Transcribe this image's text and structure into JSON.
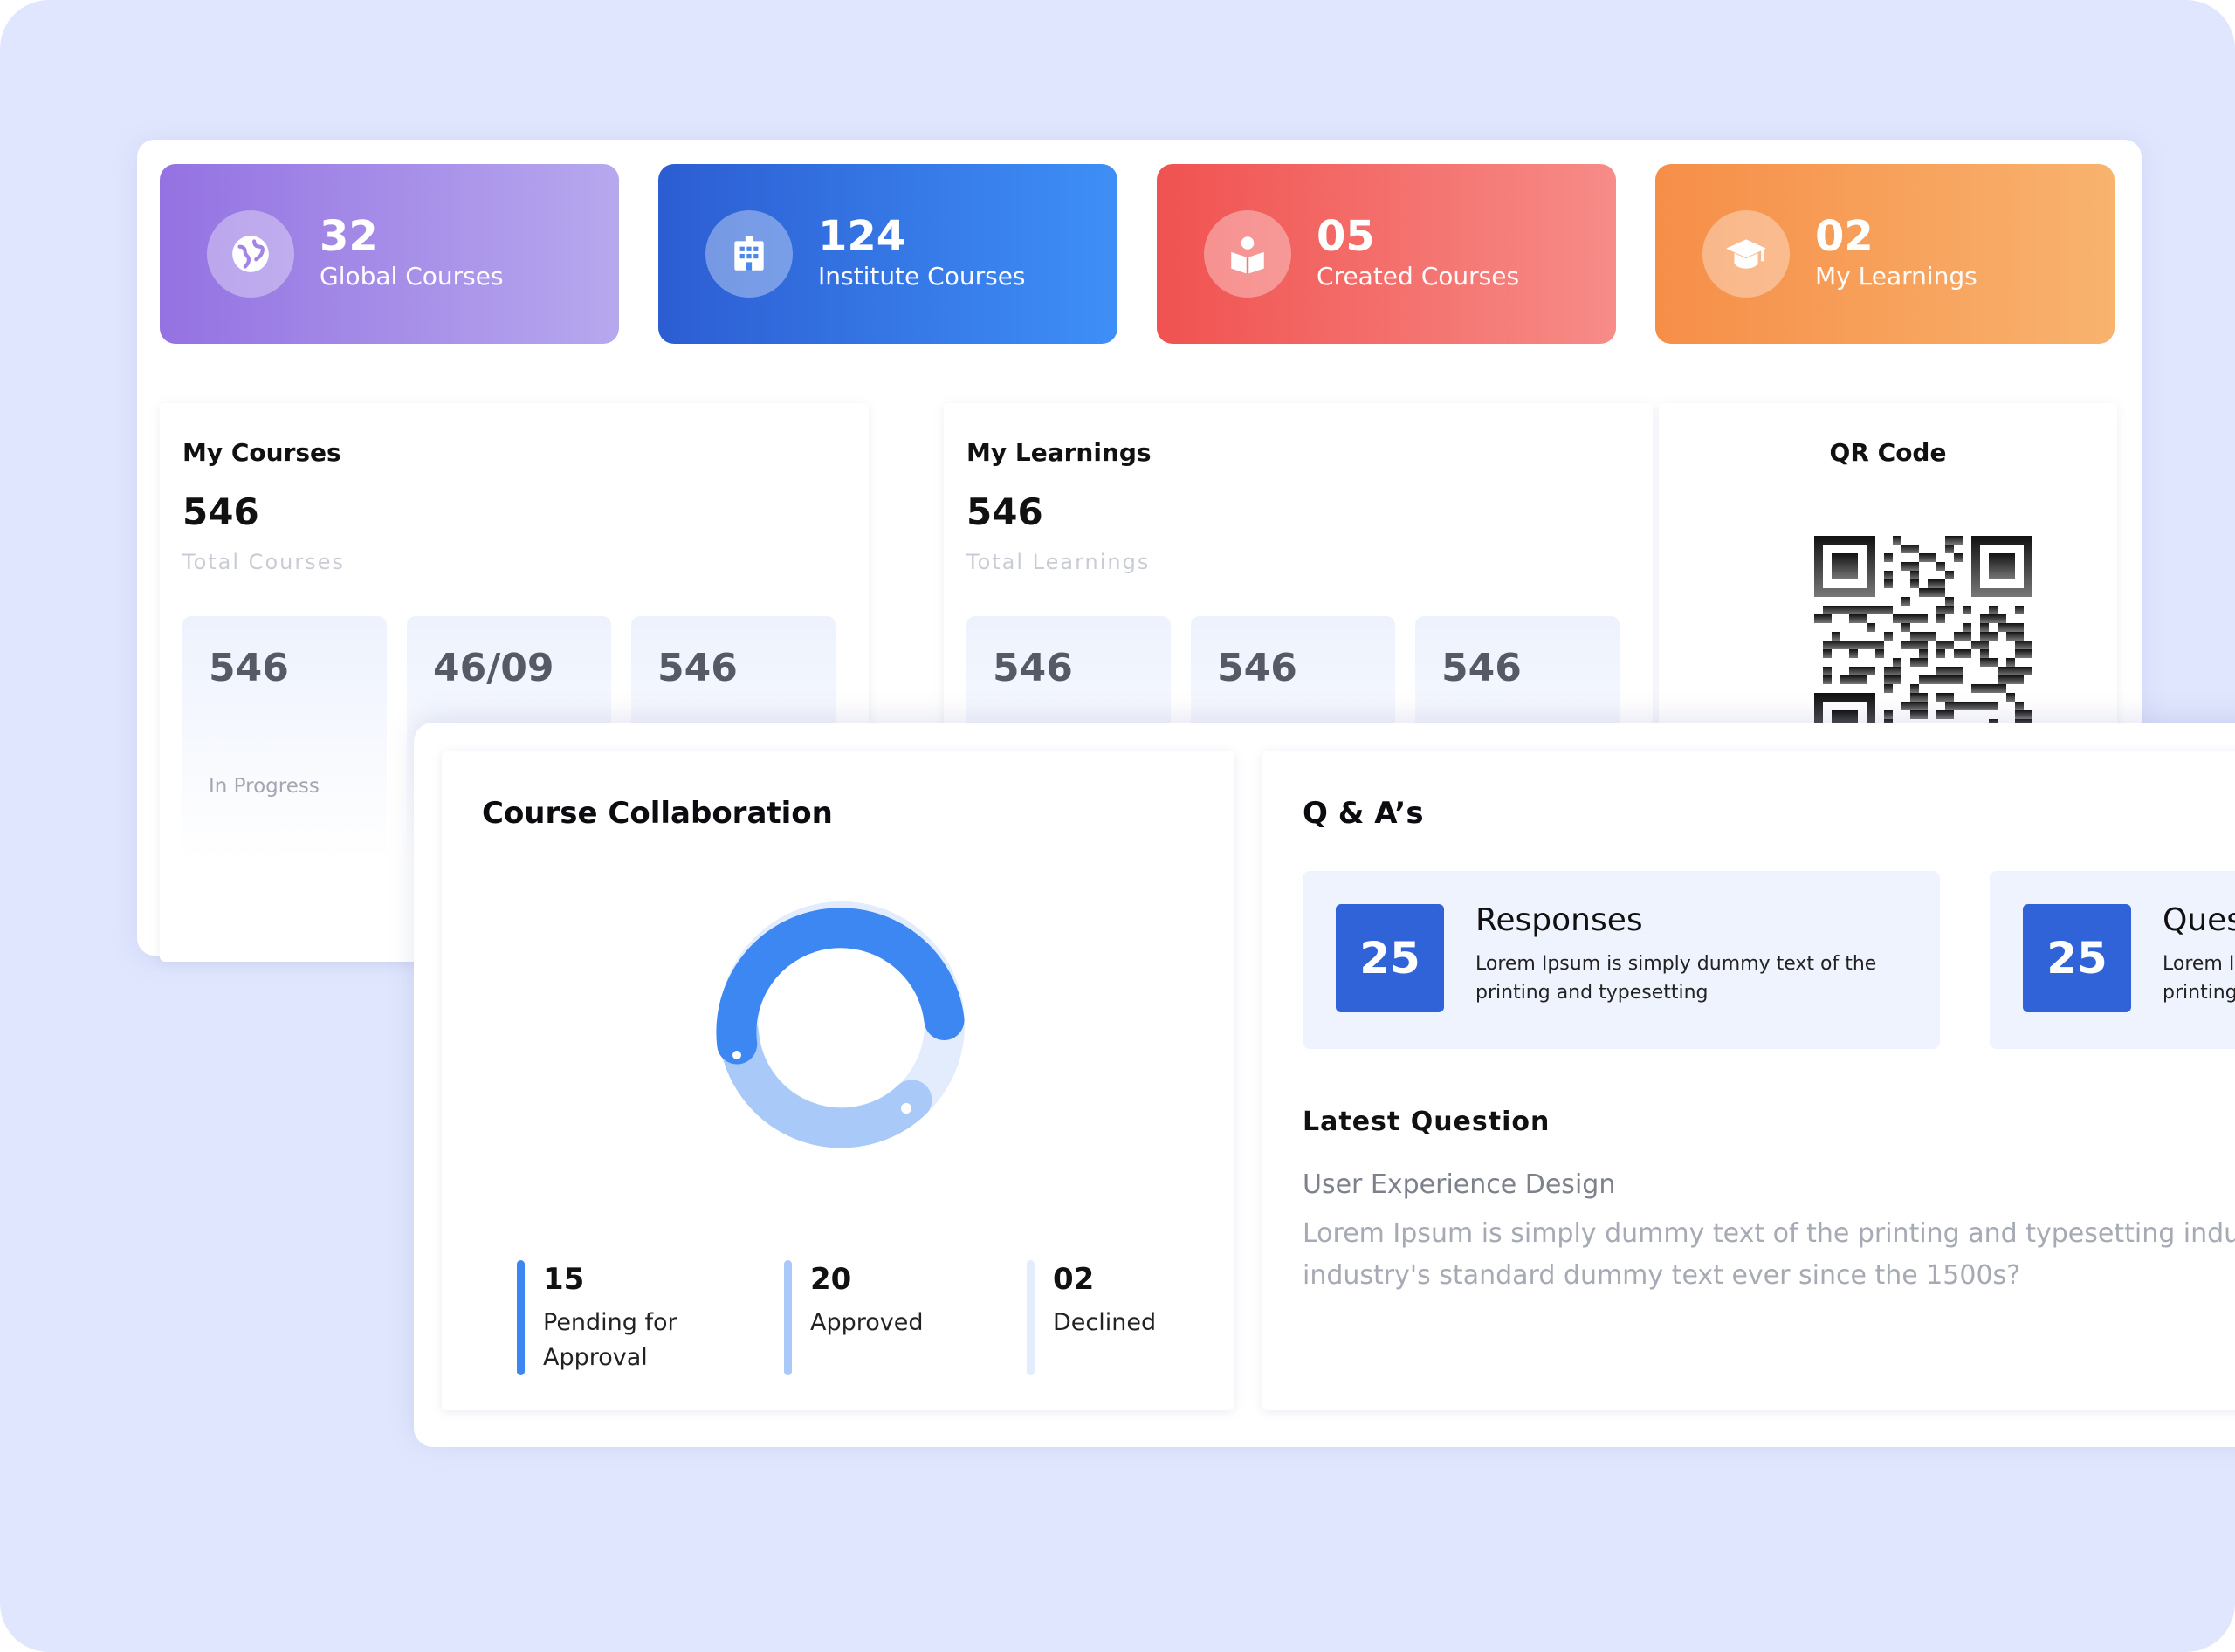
{
  "stats": [
    {
      "value": "32",
      "label": "Global Courses",
      "icon": "globe-icon"
    },
    {
      "value": "124",
      "label": "Institute Courses",
      "icon": "building-icon"
    },
    {
      "value": "05",
      "label": "Created Courses",
      "icon": "reading-person-icon"
    },
    {
      "value": "02",
      "label": "My Learnings",
      "icon": "graduation-cap-icon"
    }
  ],
  "my_courses": {
    "title": "My Courses",
    "total": "546",
    "total_label": "Total Courses",
    "tiles": [
      {
        "value": "546",
        "label": "In Progress"
      },
      {
        "value": "46/09"
      },
      {
        "value": "546"
      }
    ]
  },
  "my_learnings": {
    "title": "My Learnings",
    "total": "546",
    "total_label": "Total Learnings",
    "tiles": [
      {
        "value": "546"
      },
      {
        "value": "546"
      },
      {
        "value": "546"
      }
    ]
  },
  "qr": {
    "title": "QR Code"
  },
  "collaboration": {
    "title": "Course Collaboration",
    "legend": [
      {
        "value": "15",
        "label_lines": [
          "Pending for",
          "Approval"
        ],
        "color": "#3d87f3"
      },
      {
        "value": "20",
        "label_lines": [
          "Approved"
        ],
        "color": "#a9c9f8"
      },
      {
        "value": "02",
        "label_lines": [
          "Declined"
        ],
        "color": "#e2ecfd"
      }
    ]
  },
  "qa": {
    "title": "Q & A’s",
    "cards": [
      {
        "count": "25",
        "title": "Responses",
        "desc": "Lorem Ipsum is simply dummy text of the printing and typesetting"
      },
      {
        "count": "25",
        "title": "Ques",
        "desc": "Lorem Ip printing"
      }
    ],
    "latest_title": "Latest Question",
    "latest_subtitle": "User Experience Design",
    "latest_text": "Lorem Ipsum is simply dummy text of the printing and typesetting indus the industry's standard dummy text ever since the 1500s?"
  },
  "colors": {
    "background": "#e0e6fd",
    "accent_blue": "#2f63d7",
    "purple": "#9472e2",
    "red": "#f05250",
    "orange": "#f68e48"
  }
}
